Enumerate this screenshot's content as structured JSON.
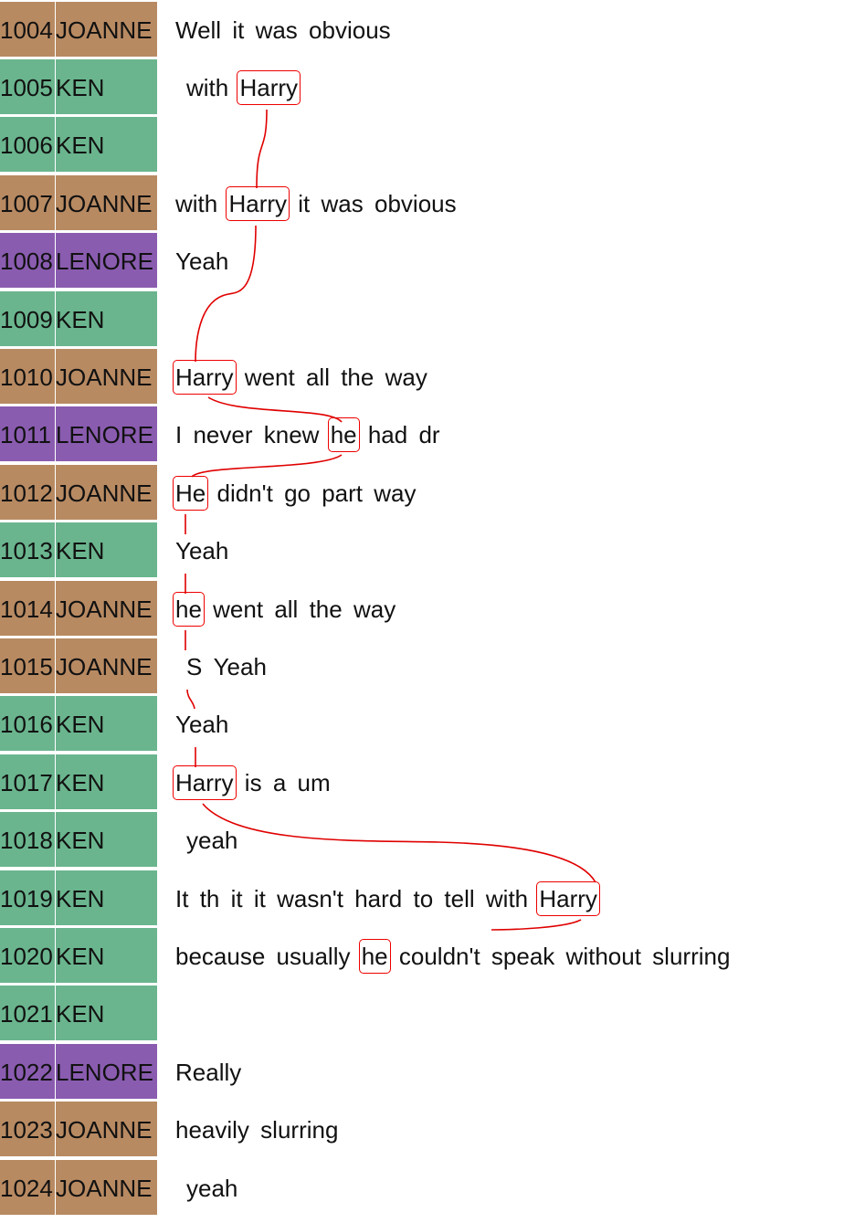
{
  "colors": {
    "JOANNE": "#b88a62",
    "KEN": "#6ab58e",
    "LENORE": "#8a5cb0",
    "link": "#e00000"
  },
  "rows": [
    {
      "num": "1004",
      "speaker": "JOANNE",
      "indent": false,
      "tokens": [
        {
          "t": "Well"
        },
        {
          "t": "it"
        },
        {
          "t": "was"
        },
        {
          "t": "obvious"
        }
      ]
    },
    {
      "num": "1005",
      "speaker": "KEN",
      "indent": true,
      "tokens": [
        {
          "t": "with"
        },
        {
          "t": "Harry",
          "box": true
        }
      ]
    },
    {
      "num": "1006",
      "speaker": "KEN",
      "indent": false,
      "tokens": []
    },
    {
      "num": "1007",
      "speaker": "JOANNE",
      "indent": false,
      "tokens": [
        {
          "t": "with"
        },
        {
          "t": "Harry",
          "box": true
        },
        {
          "t": "it"
        },
        {
          "t": "was"
        },
        {
          "t": "obvious"
        }
      ]
    },
    {
      "num": "1008",
      "speaker": "LENORE",
      "indent": false,
      "tokens": [
        {
          "t": "Yeah"
        }
      ]
    },
    {
      "num": "1009",
      "speaker": "KEN",
      "indent": false,
      "tokens": []
    },
    {
      "num": "1010",
      "speaker": "JOANNE",
      "indent": false,
      "tokens": [
        {
          "t": "Harry",
          "box": true
        },
        {
          "t": "went"
        },
        {
          "t": "all"
        },
        {
          "t": "the"
        },
        {
          "t": "way"
        }
      ]
    },
    {
      "num": "1011",
      "speaker": "LENORE",
      "indent": false,
      "tokens": [
        {
          "t": "I"
        },
        {
          "t": "never"
        },
        {
          "t": "knew"
        },
        {
          "t": "he",
          "box": true
        },
        {
          "t": "had"
        },
        {
          "t": "dr"
        }
      ]
    },
    {
      "num": "1012",
      "speaker": "JOANNE",
      "indent": false,
      "tokens": [
        {
          "t": "He",
          "box": true
        },
        {
          "t": "didn't"
        },
        {
          "t": "go"
        },
        {
          "t": "part"
        },
        {
          "t": "way"
        }
      ]
    },
    {
      "num": "1013",
      "speaker": "KEN",
      "indent": false,
      "tokens": [
        {
          "t": "Yeah"
        }
      ]
    },
    {
      "num": "1014",
      "speaker": "JOANNE",
      "indent": false,
      "tokens": [
        {
          "t": "he",
          "box": true
        },
        {
          "t": "went"
        },
        {
          "t": "all"
        },
        {
          "t": "the"
        },
        {
          "t": "way"
        }
      ]
    },
    {
      "num": "1015",
      "speaker": "JOANNE",
      "indent": true,
      "tokens": [
        {
          "t": "S"
        },
        {
          "t": "Yeah"
        }
      ]
    },
    {
      "num": "1016",
      "speaker": "KEN",
      "indent": false,
      "tokens": [
        {
          "t": "Yeah"
        }
      ]
    },
    {
      "num": "1017",
      "speaker": "KEN",
      "indent": false,
      "tokens": [
        {
          "t": "Harry",
          "box": true
        },
        {
          "t": "is"
        },
        {
          "t": "a"
        },
        {
          "t": "um"
        }
      ]
    },
    {
      "num": "1018",
      "speaker": "KEN",
      "indent": true,
      "tokens": [
        {
          "t": "yeah"
        }
      ]
    },
    {
      "num": "1019",
      "speaker": "KEN",
      "indent": false,
      "tokens": [
        {
          "t": "It"
        },
        {
          "t": "th"
        },
        {
          "t": "it"
        },
        {
          "t": "it"
        },
        {
          "t": "wasn't"
        },
        {
          "t": "hard"
        },
        {
          "t": "to"
        },
        {
          "t": "tell"
        },
        {
          "t": "with"
        },
        {
          "t": "Harry",
          "box": true
        }
      ]
    },
    {
      "num": "1020",
      "speaker": "KEN",
      "indent": false,
      "tokens": [
        {
          "t": "because"
        },
        {
          "t": "usually"
        },
        {
          "t": "he",
          "box": true
        },
        {
          "t": "couldn't"
        },
        {
          "t": "speak"
        },
        {
          "t": "without"
        },
        {
          "t": "slurring"
        }
      ]
    },
    {
      "num": "1021",
      "speaker": "KEN",
      "indent": false,
      "tokens": []
    },
    {
      "num": "1022",
      "speaker": "LENORE",
      "indent": false,
      "tokens": [
        {
          "t": "Really"
        }
      ]
    },
    {
      "num": "1023",
      "speaker": "JOANNE",
      "indent": false,
      "tokens": [
        {
          "t": "heavily"
        },
        {
          "t": "slurring"
        }
      ]
    },
    {
      "num": "1024",
      "speaker": "JOANNE",
      "indent": true,
      "tokens": [
        {
          "t": "yeah"
        }
      ]
    }
  ]
}
